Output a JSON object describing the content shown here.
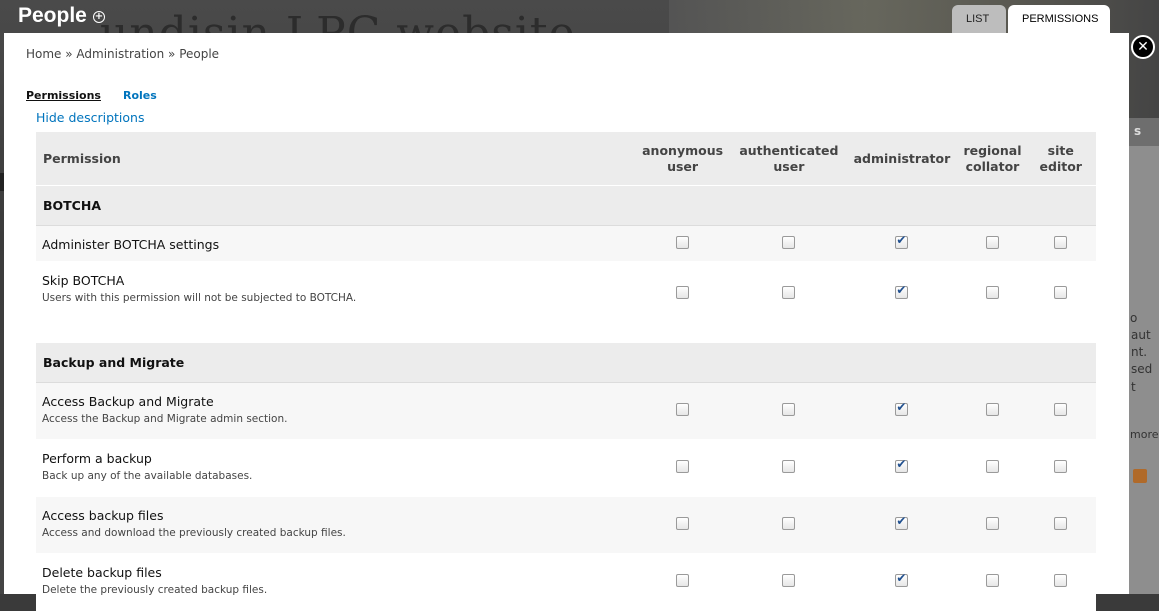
{
  "overlay": {
    "title": "People",
    "tabs": [
      "LIST",
      "PERMISSIONS"
    ],
    "active_tab": "PERMISSIONS"
  },
  "background": {
    "ghost_title": "undisin LPC website",
    "right_texts": [
      "s",
      "o",
      "aut",
      "nt.",
      "sed",
      "t",
      "more"
    ]
  },
  "breadcrumb": "Home » Administration » People",
  "subtabs": [
    "Permissions",
    "Roles"
  ],
  "hide_descriptions": "Hide descriptions",
  "table": {
    "columns": [
      "Permission",
      "anonymous user",
      "authenticated user",
      "administrator",
      "regional collator",
      "site editor"
    ],
    "groups": [
      {
        "module": "BOTCHA",
        "permissions": [
          {
            "title": "Administer BOTCHA settings",
            "description": "",
            "checked": [
              false,
              false,
              true,
              false,
              false
            ]
          },
          {
            "title": "Skip BOTCHA",
            "description": "Users with this permission will not be subjected to BOTCHA.",
            "checked": [
              false,
              false,
              true,
              false,
              false
            ]
          }
        ]
      },
      {
        "module": "Backup and Migrate",
        "permissions": [
          {
            "title": "Access Backup and Migrate",
            "description": "Access the Backup and Migrate admin section.",
            "checked": [
              false,
              false,
              true,
              false,
              false
            ]
          },
          {
            "title": "Perform a backup",
            "description": "Back up any of the available databases.",
            "checked": [
              false,
              false,
              true,
              false,
              false
            ]
          },
          {
            "title": "Access backup files",
            "description": "Access and download the previously created backup files.",
            "checked": [
              false,
              false,
              true,
              false,
              false
            ]
          },
          {
            "title": "Delete backup files",
            "description": "Delete the previously created backup files.",
            "checked": [
              false,
              false,
              true,
              false,
              false
            ]
          }
        ]
      }
    ]
  }
}
